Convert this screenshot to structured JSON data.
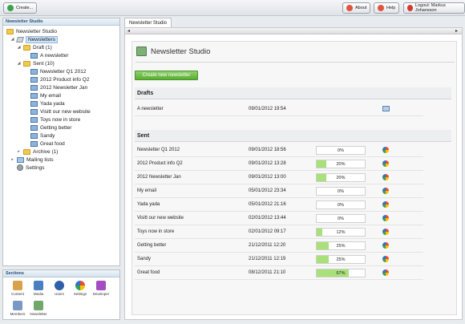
{
  "toolbar": {
    "create_label": "Create...",
    "about_label": "About",
    "help_label": "Help",
    "logout_label": "Logout: Markus Johansson"
  },
  "tree": {
    "header": "Newsletter Studio",
    "root": "Newsletter Studio",
    "newsletters": "Newsletters",
    "draft": "Draft (1)",
    "draft_items": [
      "A newsletter"
    ],
    "sent": "Sent (10)",
    "sent_items": [
      "Newsletter Q1 2012",
      "2012 Product info Q2",
      "2012 Newsletter Jan",
      "My email",
      "Yada yada",
      "Visitt our new website",
      "Toys now in store",
      "Getting better",
      "Sandy",
      "Great food"
    ],
    "archive": "Archive (1)",
    "mailing_lists": "Mailing lists",
    "settings": "Settings"
  },
  "sections": {
    "header": "Sections",
    "items": [
      {
        "label": "Content",
        "icon": "content-icon",
        "color": "#d8a24a"
      },
      {
        "label": "Media",
        "icon": "media-icon",
        "color": "#4a7fc2"
      },
      {
        "label": "Users",
        "icon": "users-icon",
        "color": "#2f5fa8"
      },
      {
        "label": "Settings",
        "icon": "settings-icon",
        "color": "#e0a020"
      },
      {
        "label": "Developer",
        "icon": "developer-icon",
        "color": "#a44cc2"
      },
      {
        "label": "Members",
        "icon": "members-icon",
        "color": "#7a98c4"
      },
      {
        "label": "Newsletter",
        "icon": "newsletter-icon",
        "color": "#6fa86a"
      }
    ]
  },
  "main": {
    "tab_label": "Newsletter Studio",
    "title": "Newsletter Studio",
    "create_button": "Create new newsletter",
    "drafts_header": "Drafts",
    "drafts": [
      {
        "name": "A newsletter",
        "date": "09/01/2012 19:54"
      }
    ],
    "sent_header": "Sent",
    "sent": [
      {
        "name": "Newsletter Q1 2012",
        "date": "09/01/2012 18:56",
        "progress": "0%",
        "value": 0
      },
      {
        "name": "2012 Product info Q2",
        "date": "09/01/2012 13:28",
        "progress": "20%",
        "value": 20
      },
      {
        "name": "2012 Newsletter Jan",
        "date": "09/01/2012 13:00",
        "progress": "20%",
        "value": 20
      },
      {
        "name": "My email",
        "date": "05/01/2012 23:34",
        "progress": "0%",
        "value": 0
      },
      {
        "name": "Yada yada",
        "date": "05/01/2012 21:16",
        "progress": "0%",
        "value": 0
      },
      {
        "name": "Visitt our new website",
        "date": "02/01/2012 13:44",
        "progress": "0%",
        "value": 0
      },
      {
        "name": "Toys now in store",
        "date": "02/01/2012 09:17",
        "progress": "12%",
        "value": 12
      },
      {
        "name": "Getting better",
        "date": "21/12/2011 12:20",
        "progress": "25%",
        "value": 25
      },
      {
        "name": "Sandy",
        "date": "21/12/2011 12:19",
        "progress": "25%",
        "value": 25
      },
      {
        "name": "Great food",
        "date": "08/12/2011 21:10",
        "progress": "67%",
        "value": 67
      }
    ]
  }
}
